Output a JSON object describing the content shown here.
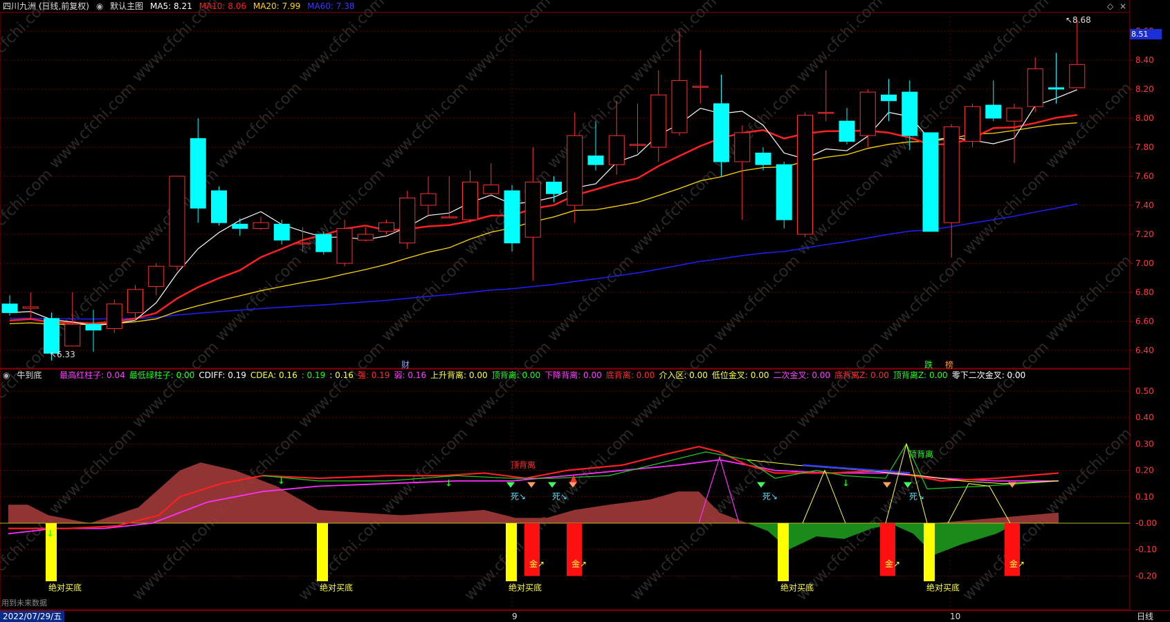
{
  "header": {
    "stock_name": "四川九洲 (日线,前复权)",
    "main_chart_label": "默认主图",
    "ma5": "MA5: 8.21",
    "ma10": "MA10: 8.06",
    "ma20": "MA20: 7.99",
    "ma60": "MA60: 7.38"
  },
  "colors": {
    "up": "#ff3030",
    "down": "#00ffff",
    "ma5": "#ffffff",
    "ma10": "#ff2020",
    "ma20": "#ffd700",
    "ma60": "#2020ff",
    "grid": "#8b0000"
  },
  "price_axis": {
    "ticks": [
      "8.60",
      "8.40",
      "8.20",
      "8.00",
      "7.80",
      "7.60",
      "7.40",
      "7.20",
      "7.00",
      "6.80",
      "6.60",
      "6.40"
    ],
    "current_price": "8.51",
    "high_label": "8.68",
    "low_label": "6.33"
  },
  "markers": {
    "cai": "财",
    "die": "跌",
    "bang": "榜"
  },
  "indicator": {
    "name": "牛到底",
    "values": [
      {
        "text": "最高红柱子: 0.04",
        "color": "#ff40ff"
      },
      {
        "text": "最低绿柱子: 0.00",
        "color": "#20ff20"
      },
      {
        "text": "CDIFF: 0.19",
        "color": "#ffffff"
      },
      {
        "text": "CDEA: 0.16",
        "color": "#ffff40"
      },
      {
        "text": ": 0.19",
        "color": "#20ff20"
      },
      {
        "text": ": 0.16",
        "color": "#ffff40"
      },
      {
        "text": "强: 0.19",
        "color": "#ff3030"
      },
      {
        "text": "弱: 0.16",
        "color": "#ff40ff"
      },
      {
        "text": "上升背离: 0.00",
        "color": "#ffff40"
      },
      {
        "text": "顶背离: 0.00",
        "color": "#20ff20"
      },
      {
        "text": "下降背离: 0.00",
        "color": "#ff40ff"
      },
      {
        "text": "底背离: 0.00",
        "color": "#ff3030"
      },
      {
        "text": "介入区: 0.00",
        "color": "#ffff40"
      },
      {
        "text": "低位金叉: 0.00",
        "color": "#ffff40"
      },
      {
        "text": "二次金叉: 0.00",
        "color": "#ff40ff"
      },
      {
        "text": "底背离Z: 0.00",
        "color": "#ff3030"
      },
      {
        "text": "顶背离Z: 0.00",
        "color": "#20ff20"
      },
      {
        "text": "零下二次金叉: 0.00",
        "color": "#ffffff"
      }
    ],
    "axis_ticks": [
      "0.50",
      "0.40",
      "0.30",
      "0.20",
      "0.10",
      "-0.00",
      "-0.10",
      "-0.20"
    ],
    "labels": {
      "abs_buy": "绝对买底",
      "top_div": "顶背离",
      "death": "死↘",
      "gold": "金↗"
    }
  },
  "footer": {
    "future_data": "用到未来数据",
    "date": "2022/07/29/五",
    "month_9": "9",
    "month_10": "10",
    "period": "日线"
  },
  "watermark": "www.cfchi.com",
  "chart_data": {
    "type": "candlestick",
    "candles": [
      [
        6.72,
        6.66,
        6.78,
        6.64
      ],
      [
        6.69,
        6.7,
        6.8,
        6.62
      ],
      [
        6.62,
        6.38,
        6.66,
        6.33
      ],
      [
        6.43,
        6.58,
        6.8,
        6.43
      ],
      [
        6.58,
        6.54,
        6.68,
        6.39
      ],
      [
        6.55,
        6.72,
        6.75,
        6.52
      ],
      [
        6.66,
        6.82,
        6.85,
        6.6
      ],
      [
        6.84,
        6.98,
        7.0,
        6.78
      ],
      [
        6.98,
        7.6,
        7.6,
        6.95
      ],
      [
        7.86,
        7.38,
        8.0,
        7.28
      ],
      [
        7.5,
        7.28,
        7.53,
        7.26
      ],
      [
        7.27,
        7.24,
        7.31,
        7.19
      ],
      [
        7.24,
        7.28,
        7.32,
        7.23
      ],
      [
        7.27,
        7.16,
        7.3,
        7.13
      ],
      [
        7.14,
        7.14,
        7.25,
        7.08
      ],
      [
        7.2,
        7.08,
        7.22,
        7.06
      ],
      [
        7.0,
        7.24,
        7.3,
        6.98
      ],
      [
        7.16,
        7.2,
        7.25,
        7.15
      ],
      [
        7.22,
        7.28,
        7.3,
        7.2
      ],
      [
        7.14,
        7.45,
        7.5,
        7.1
      ],
      [
        7.4,
        7.48,
        7.6,
        7.32
      ],
      [
        7.32,
        7.32,
        7.6,
        7.31
      ],
      [
        7.3,
        7.56,
        7.64,
        7.28
      ],
      [
        7.48,
        7.54,
        7.69,
        7.46
      ],
      [
        7.5,
        7.14,
        7.54,
        7.08
      ],
      [
        7.18,
        7.56,
        7.8,
        6.88
      ],
      [
        7.56,
        7.48,
        7.6,
        7.42
      ],
      [
        7.4,
        7.88,
        8.04,
        7.28
      ],
      [
        7.74,
        7.68,
        7.98,
        7.64
      ],
      [
        7.68,
        7.88,
        8.12,
        7.61
      ],
      [
        7.82,
        7.82,
        8.1,
        7.76
      ],
      [
        7.8,
        8.16,
        8.33,
        7.7
      ],
      [
        7.9,
        8.26,
        8.6,
        7.88
      ],
      [
        8.22,
        8.22,
        8.47,
        8.1
      ],
      [
        8.1,
        7.7,
        8.3,
        7.6
      ],
      [
        7.7,
        7.9,
        7.95,
        7.3
      ],
      [
        7.76,
        7.68,
        7.8,
        7.64
      ],
      [
        7.68,
        7.3,
        7.7,
        7.24
      ],
      [
        7.2,
        8.02,
        8.04,
        7.18
      ],
      [
        8.04,
        8.04,
        8.33,
        7.98
      ],
      [
        7.98,
        7.84,
        8.07,
        7.82
      ],
      [
        7.88,
        8.18,
        8.2,
        7.8
      ],
      [
        8.16,
        8.12,
        8.27,
        7.98
      ],
      [
        8.18,
        7.88,
        8.26,
        7.78
      ],
      [
        7.9,
        7.22,
        7.9,
        7.22
      ],
      [
        7.28,
        7.94,
        7.96,
        7.04
      ],
      [
        7.84,
        8.08,
        8.1,
        7.8
      ],
      [
        8.09,
        8.0,
        8.26,
        7.98
      ],
      [
        7.98,
        8.07,
        8.1,
        7.69
      ],
      [
        8.08,
        8.34,
        8.42,
        8.04
      ],
      [
        8.21,
        8.2,
        8.45,
        8.1
      ],
      [
        8.21,
        8.37,
        8.68,
        8.21
      ]
    ]
  }
}
